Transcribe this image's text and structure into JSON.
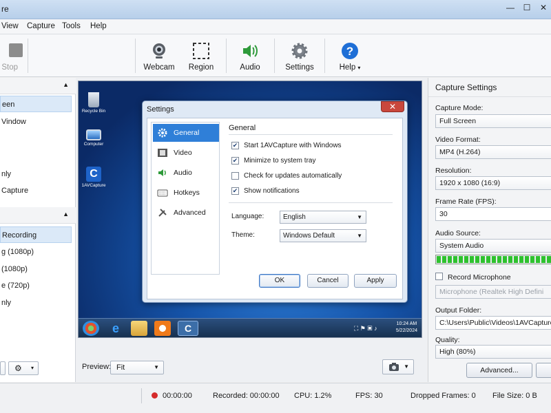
{
  "window": {
    "title_fragment": "re",
    "min": "—",
    "max": "☐",
    "close": "✕"
  },
  "menu": [
    "View",
    "Capture",
    "Tools",
    "Help"
  ],
  "toolbar": {
    "stop": "Stop",
    "webcam": "Webcam",
    "region": "Region",
    "audio": "Audio",
    "settings": "Settings",
    "help": "Help",
    "help_caret": "▾"
  },
  "left_panel": {
    "section1_items": [
      "een",
      "Vindow",
      "",
      "nly",
      "Capture"
    ],
    "section2_items": [
      "Recording",
      "g (1080p)",
      " (1080p)",
      "e (720p)",
      "nly"
    ],
    "gear_caret": "▾"
  },
  "desktop": {
    "icons": [
      "Recycle Bin",
      "Computer",
      "1AVCapture"
    ],
    "clock_time": "10:24 AM",
    "clock_date": "5/22/2024"
  },
  "settings_dialog": {
    "title": "Settings",
    "close": "✕",
    "nav": [
      "General",
      "Video",
      "Audio",
      "Hotkeys",
      "Advanced"
    ],
    "section_title": "General",
    "checkboxes": [
      {
        "label": "Start 1AVCapture with Windows",
        "checked": true
      },
      {
        "label": "Minimize to system tray",
        "checked": true
      },
      {
        "label": "Check for updates automatically",
        "checked": false
      },
      {
        "label": "Show notifications",
        "checked": true
      }
    ],
    "language_label": "Language:",
    "language_value": "English",
    "theme_label": "Theme:",
    "theme_value": "Windows Default",
    "ok": "OK",
    "cancel": "Cancel",
    "apply": "Apply"
  },
  "preview": {
    "label": "Preview:",
    "value": "Fit"
  },
  "capture_settings": {
    "title": "Capture Settings",
    "mode_label": "Capture Mode:",
    "mode_value": "Full Screen",
    "format_label": "Video Format:",
    "format_value": "MP4 (H.264)",
    "resolution_label": "Resolution:",
    "resolution_value": "1920 x 1080 (16:9)",
    "fps_label": "Frame Rate (FPS):",
    "fps_value": "30",
    "audio_label": "Audio Source:",
    "audio_value": "System Audio",
    "audio_level": 1.0,
    "record_mic_label": "Record Microphone",
    "record_mic_checked": false,
    "mic_value": "Microphone (Realtek High Defini",
    "folder_label": "Output Folder:",
    "folder_value": "C:\\Users\\Public\\Videos\\1AVCapture",
    "quality_label": "Quality:",
    "quality_value": "High (80%)",
    "advanced": "Advanced..."
  },
  "status": {
    "elapsed": "00:00:00",
    "recorded": "Recorded: 00:00:00",
    "cpu": "CPU: 1.2%",
    "fps": "FPS: 30",
    "dropped": "Dropped Frames: 0",
    "filesize": "File Size: 0 B"
  },
  "colors": {
    "accent": "#2f7fd8",
    "record": "#d52b2b",
    "meter": "#2ec22e"
  }
}
